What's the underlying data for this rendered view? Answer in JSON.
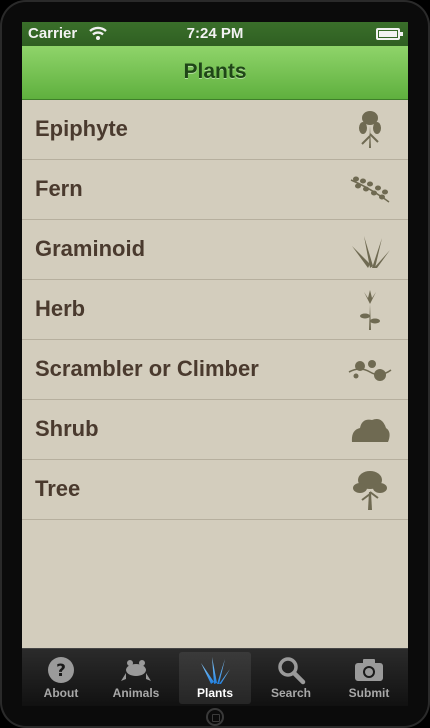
{
  "status": {
    "carrier": "Carrier",
    "time": "7:24 PM"
  },
  "nav": {
    "title": "Plants"
  },
  "list": {
    "items": [
      {
        "label": "Epiphyte",
        "icon": "epiphyte-icon"
      },
      {
        "label": "Fern",
        "icon": "fern-icon"
      },
      {
        "label": "Graminoid",
        "icon": "grass-icon"
      },
      {
        "label": "Herb",
        "icon": "herb-flower-icon"
      },
      {
        "label": "Scrambler or Climber",
        "icon": "climber-vine-icon"
      },
      {
        "label": "Shrub",
        "icon": "shrub-icon"
      },
      {
        "label": "Tree",
        "icon": "tree-icon"
      }
    ]
  },
  "tabbar": {
    "tabs": [
      {
        "label": "About",
        "icon": "question-icon"
      },
      {
        "label": "Animals",
        "icon": "frog-icon"
      },
      {
        "label": "Plants",
        "icon": "grass-icon",
        "active": true
      },
      {
        "label": "Search",
        "icon": "search-icon"
      },
      {
        "label": "Submit",
        "icon": "camera-icon"
      }
    ]
  },
  "colors": {
    "nav_green": "#5fb03e",
    "status_green": "#2f5f22",
    "list_bg": "#d3cdbd",
    "text_brown": "#4a3a2e",
    "icon_olive": "#6f6a52",
    "tab_active_blue": "#3fa7ff"
  }
}
